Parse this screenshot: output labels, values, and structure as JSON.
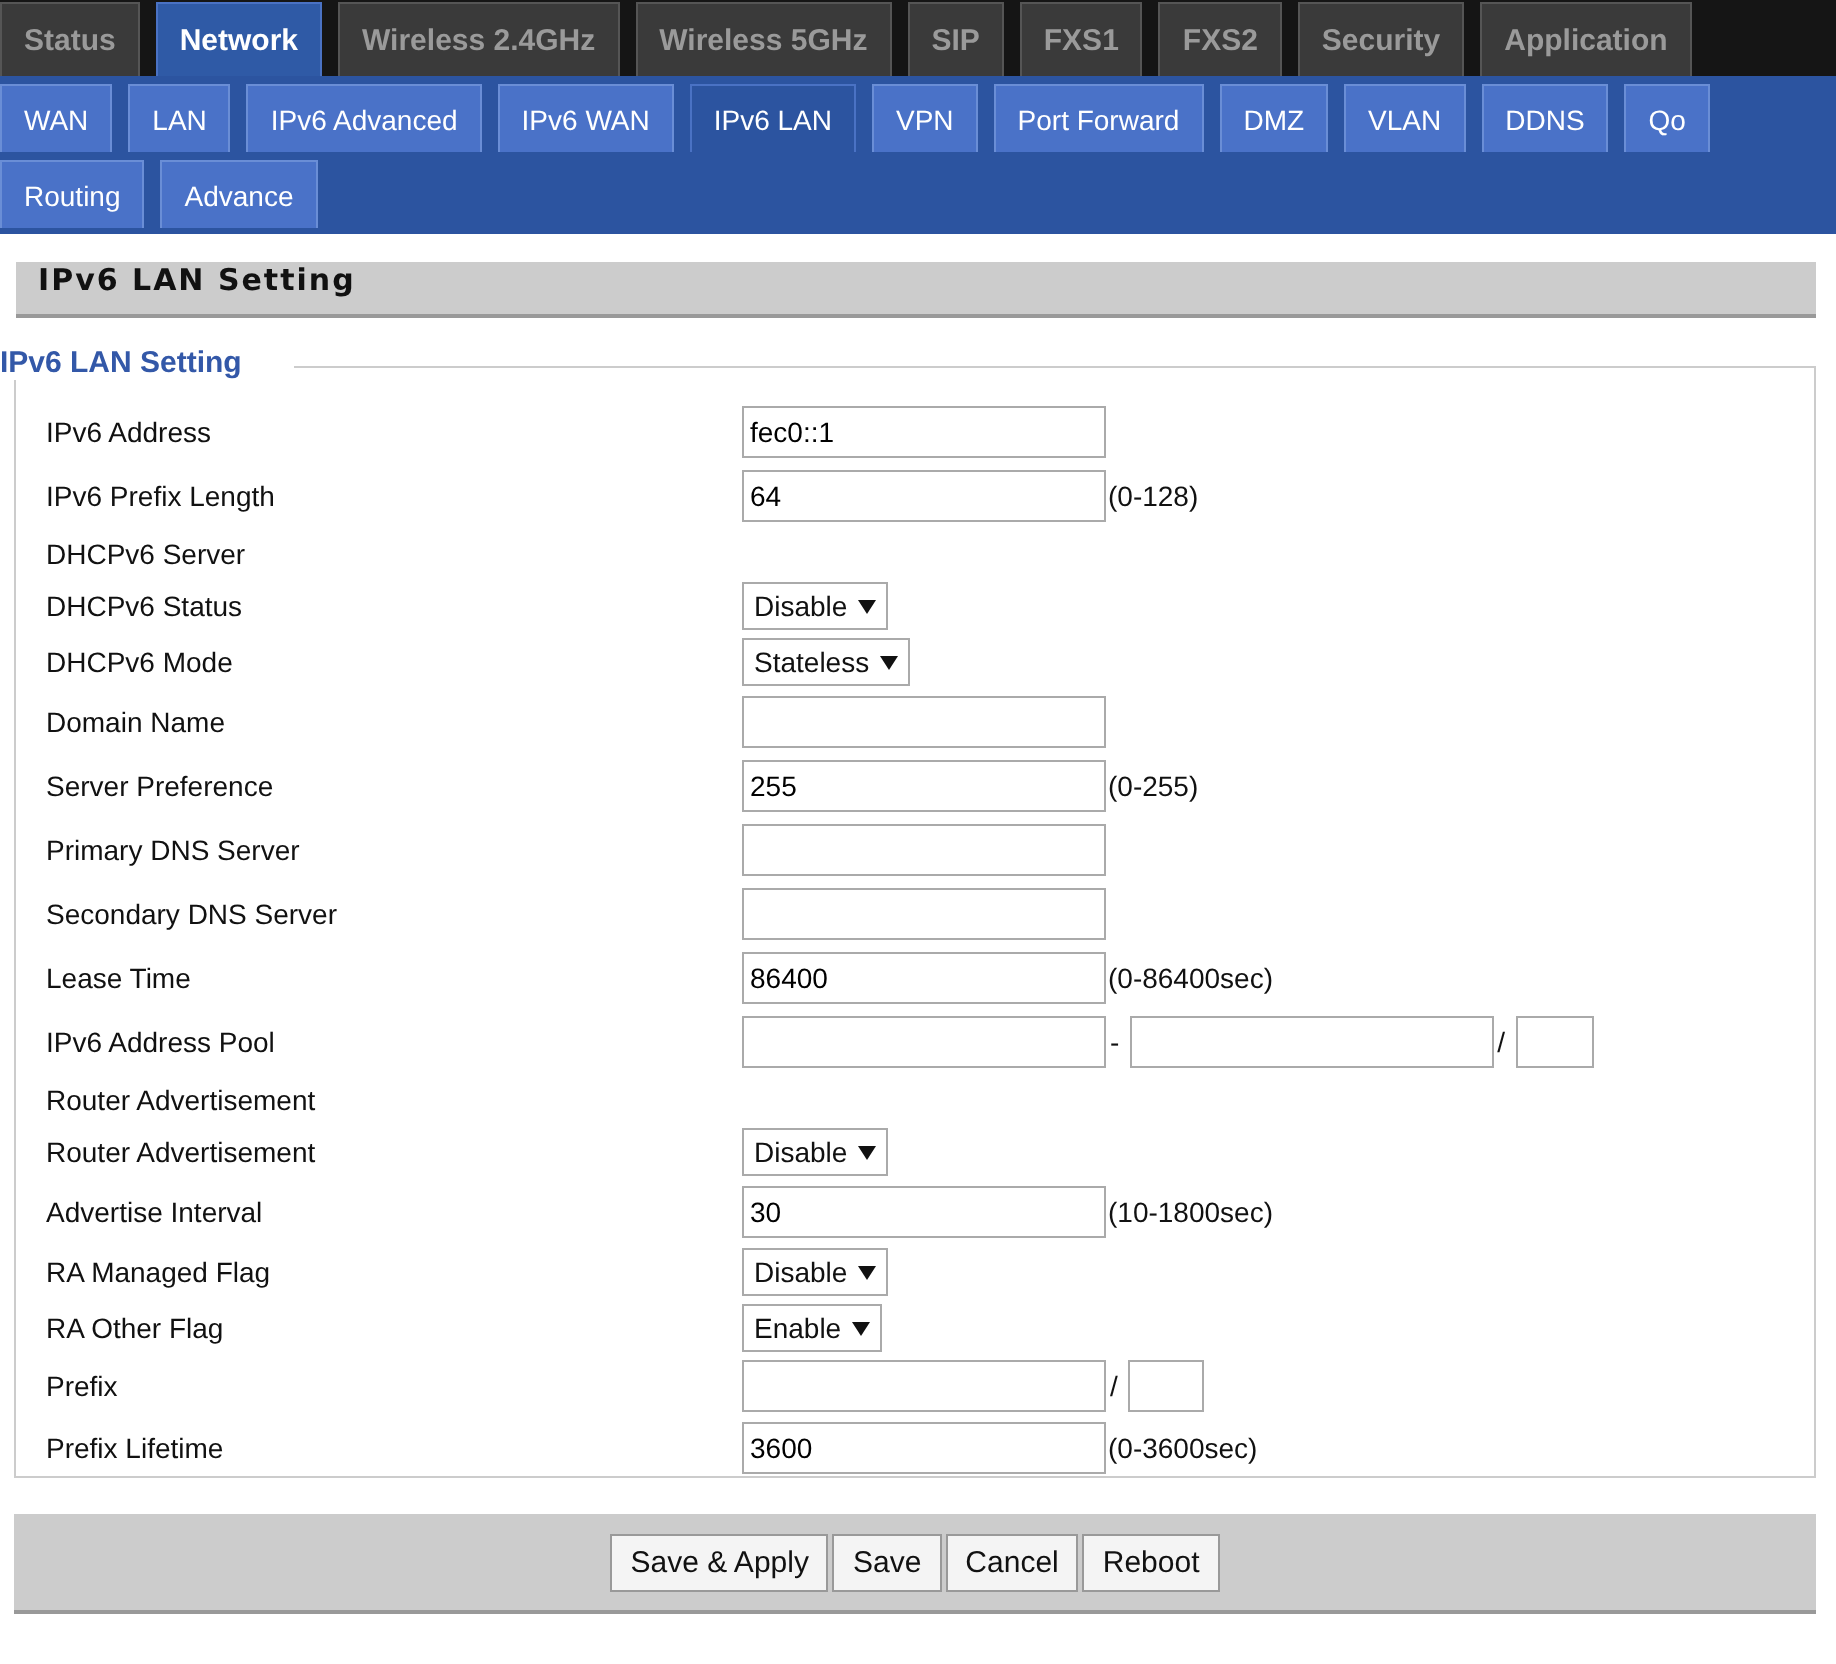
{
  "main_tabs": [
    {
      "label": "Status",
      "selected": false
    },
    {
      "label": "Network",
      "selected": true
    },
    {
      "label": "Wireless 2.4GHz",
      "selected": false
    },
    {
      "label": "Wireless 5GHz",
      "selected": false
    },
    {
      "label": "SIP",
      "selected": false
    },
    {
      "label": "FXS1",
      "selected": false
    },
    {
      "label": "FXS2",
      "selected": false
    },
    {
      "label": "Security",
      "selected": false
    },
    {
      "label": "Application",
      "selected": false
    }
  ],
  "sub_tab_rows": [
    [
      {
        "label": "WAN",
        "selected": false
      },
      {
        "label": "LAN",
        "selected": false
      },
      {
        "label": "IPv6 Advanced",
        "selected": false
      },
      {
        "label": "IPv6 WAN",
        "selected": false
      },
      {
        "label": "IPv6 LAN",
        "selected": true
      },
      {
        "label": "VPN",
        "selected": false
      },
      {
        "label": "Port Forward",
        "selected": false
      },
      {
        "label": "DMZ",
        "selected": false
      },
      {
        "label": "VLAN",
        "selected": false
      },
      {
        "label": "DDNS",
        "selected": false
      },
      {
        "label": "Qo",
        "selected": false
      }
    ],
    [
      {
        "label": "Routing",
        "selected": false
      },
      {
        "label": "Advance",
        "selected": false
      }
    ]
  ],
  "section_header": "IPv6 LAN Setting",
  "fieldset": {
    "legend": "IPv6 LAN Setting",
    "rows": [
      {
        "kind": "text",
        "label": "IPv6 Address",
        "value": "fec0::1"
      },
      {
        "kind": "text",
        "label": "IPv6 Prefix Length",
        "value": "64",
        "hint": "(0-128)"
      },
      {
        "kind": "section",
        "label": "DHCPv6 Server"
      },
      {
        "kind": "select",
        "label": "DHCPv6 Status",
        "value": "Disable"
      },
      {
        "kind": "select",
        "label": "DHCPv6 Mode",
        "value": "Stateless"
      },
      {
        "kind": "text",
        "label": "Domain Name"
      },
      {
        "kind": "text",
        "label": "Server Preference",
        "value": "255",
        "hint": "(0-255)"
      },
      {
        "kind": "text",
        "label": "Primary DNS Server"
      },
      {
        "kind": "text",
        "label": "Secondary DNS Server"
      },
      {
        "kind": "text",
        "label": "Lease Time",
        "value": "86400",
        "hint": "(0-86400sec)"
      },
      {
        "kind": "pool",
        "label": "IPv6 Address Pool",
        "separators": [
          "-",
          "/"
        ]
      },
      {
        "kind": "section",
        "label": "Router Advertisement"
      },
      {
        "kind": "select",
        "label": "Router Advertisement",
        "value": "Disable"
      },
      {
        "kind": "text",
        "label": "Advertise Interval",
        "value": "30",
        "hint": "(10-1800sec)"
      },
      {
        "kind": "select",
        "label": "RA Managed Flag",
        "value": "Disable"
      },
      {
        "kind": "select",
        "label": "RA Other Flag",
        "value": "Enable"
      },
      {
        "kind": "prefix",
        "label": "Prefix",
        "separators": [
          "/"
        ]
      },
      {
        "kind": "text",
        "label": "Prefix Lifetime",
        "value": "3600",
        "hint": "(0-3600sec)"
      }
    ]
  },
  "buttons": [
    "Save & Apply",
    "Save",
    "Cancel",
    "Reboot"
  ]
}
